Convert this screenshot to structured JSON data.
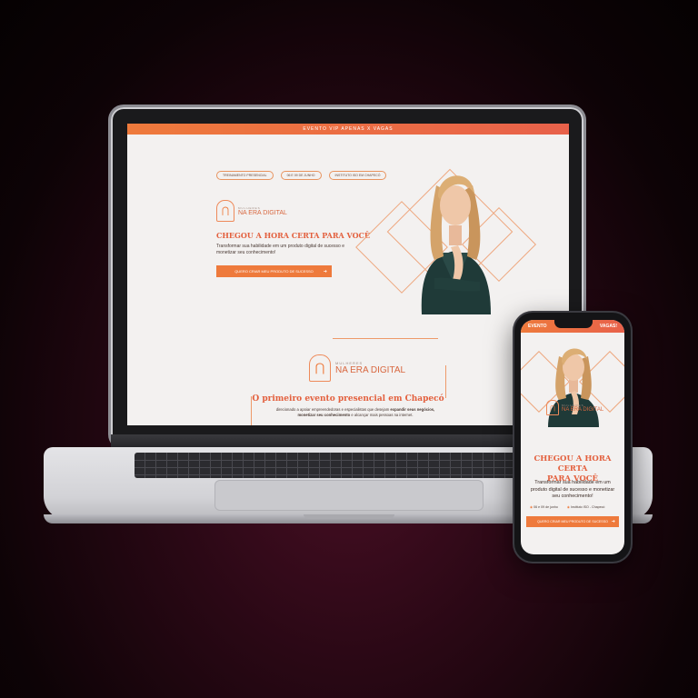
{
  "laptop": {
    "topbar": "EVENTO VIP APENAS X VAGAS",
    "pills": [
      "TREINAMENTO PRESENCIAL",
      "06 E 09 DE JUNHO",
      "INSTITUTO ISO EM CHAPECÓ"
    ],
    "logo_small": "MULHERES",
    "logo_text": "NA ERA DIGITAL",
    "headline": "CHEGOU A HORA CERTA PARA VOCÊ",
    "subtext": "Transformar sua habilidade em um produto digital de sucesso e monetizar seu conhecimento!",
    "cta": "QUERO CRIAR MEU PRODUTO DE SUCESSO",
    "logo2_small": "MULHERES",
    "logo2_text": "NA ERA DIGITAL",
    "event_title": "O primeiro evento presencial em Chapecó",
    "event_desc_a": "direcionado a apoiar empreendedoras e especialistas que desejam ",
    "event_desc_b": "expandir seus negócios, monetizar seu conhecimento",
    "event_desc_c": " e alcançar mais pessoas na internet."
  },
  "phone": {
    "top_left": "EVENTO",
    "top_right": "VAGAS!",
    "logo_small": "MULHERES",
    "logo_text": "NA ERA DIGITAL",
    "headline_line1": "CHEGOU A HORA CERTA",
    "headline_line2": "PARA VOCÊ",
    "text": "Transformar sua habilidade em um produto digital de sucesso e monetizar seu conhecimento!",
    "info_date": "06 e 09 de junho",
    "info_place": "Instituto ISO - Chapecó",
    "cta": "QUERO CRIAR MEU PRODUTO DE SUCESSO"
  },
  "icons": {
    "cta_arrow": "arrow-right-icon",
    "logo": "arch-logo-icon"
  },
  "colors": {
    "accent": "#ee7a3c",
    "headline": "#e3603e",
    "background": "#2a0815"
  }
}
